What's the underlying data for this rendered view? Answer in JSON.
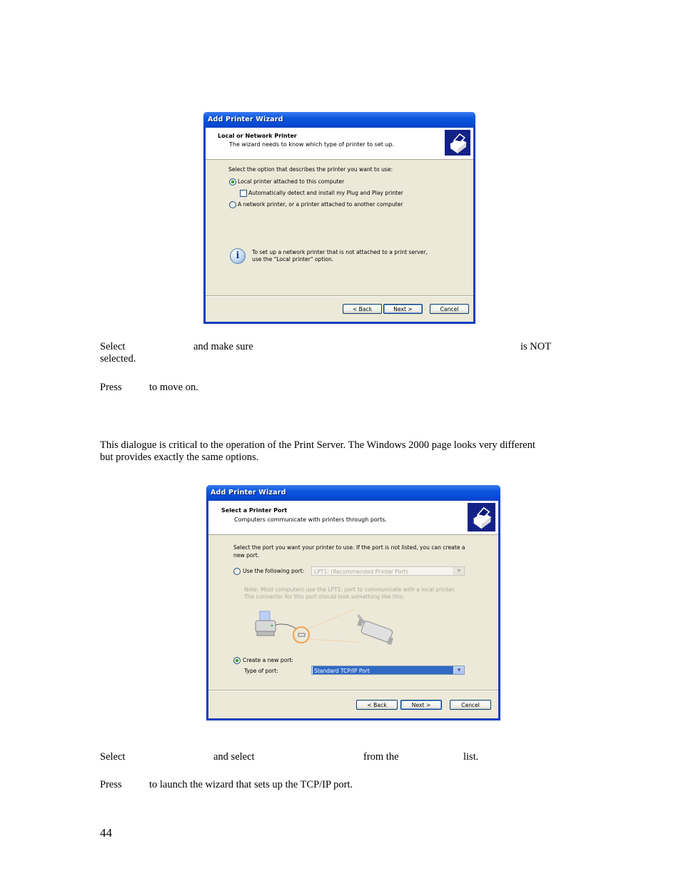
{
  "dialog1": {
    "title": "Add Printer Wizard",
    "header_title": "Local or Network Printer",
    "header_subtitle": "The wizard needs to know which type of printer to set up.",
    "header_icon": "printer-icon",
    "prompt": "Select the option that describes the printer you want to use:",
    "options": [
      {
        "label": "Local printer attached to this computer",
        "type": "radio",
        "selected": true
      },
      {
        "label": "Automatically detect and install my Plug and Play printer",
        "type": "checkbox",
        "checked": false
      },
      {
        "label": "A network printer, or a printer attached to another computer",
        "type": "radio",
        "selected": false
      }
    ],
    "info_line1": "To set up a network printer that is not attached to a print server,",
    "info_line2": "use the \"Local printer\" option.",
    "buttons": {
      "back": "< Back",
      "next": "Next >",
      "cancel": "Cancel"
    }
  },
  "text1": {
    "line1_a": "Select",
    "line1_b": "and make sure",
    "line1_c": "is NOT",
    "line2": "selected.",
    "press_a": "Press",
    "press_b": "to move on."
  },
  "text2": {
    "paragraph_line1": "This dialogue is critical to the operation of the Print Server.  The Windows 2000 page looks very different",
    "paragraph_line2": "but provides exactly the same options."
  },
  "dialog2": {
    "title": "Add Printer Wizard",
    "header_title": "Select a Printer Port",
    "header_subtitle": "Computers communicate with printers through ports.",
    "header_icon": "printer-icon",
    "prompt_line1": "Select the port you want your printer to use.  If the port is not listed, you can create a",
    "prompt_line2": "new port.",
    "use_port_label": "Use the following port:",
    "use_port_selected": false,
    "use_port_value": "LPT1: (Recommended Printer Port)",
    "note_line1": "Note: Most computers use the LPT1: port to communicate with a local printer.",
    "note_line2": "The connector for this port should look something like this:",
    "create_port_label": "Create a new port:",
    "create_port_selected": true,
    "type_of_port_label": "Type of port:",
    "type_of_port_value": "Standard TCP/IP Port",
    "buttons": {
      "back": "< Back",
      "next": "Next >",
      "cancel": "Cancel"
    }
  },
  "text3": {
    "line1_a": "Select",
    "line1_b": "and select",
    "line1_c": "from the",
    "line1_d": "list.",
    "press_a": "Press",
    "press_b": "to launch the wizard that sets up the TCP/IP port."
  },
  "page_number": "44"
}
